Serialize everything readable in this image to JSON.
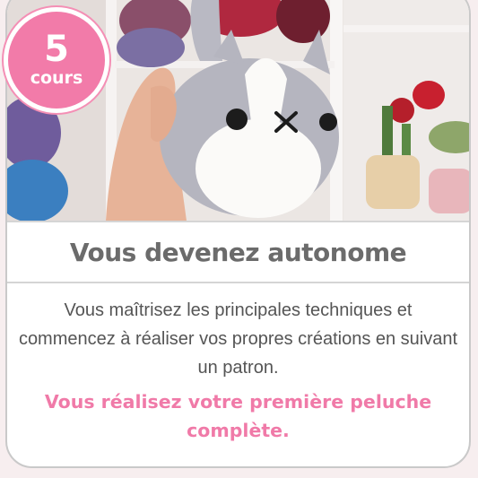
{
  "badge": {
    "number": "5",
    "unit": "cours"
  },
  "card": {
    "title": "Vous devenez autonome",
    "description": "Vous maîtrisez les principales techniques et commencez à réaliser vos propres créations en suivant un patron.",
    "highlight": "Vous réalisez votre première peluche complète."
  },
  "colors": {
    "accent_pink": "#f27ba9",
    "title_gray": "#6b6b6b",
    "border_gray": "#c9c9c9"
  },
  "icons": [
    "crochet-cat-plush-photo"
  ]
}
